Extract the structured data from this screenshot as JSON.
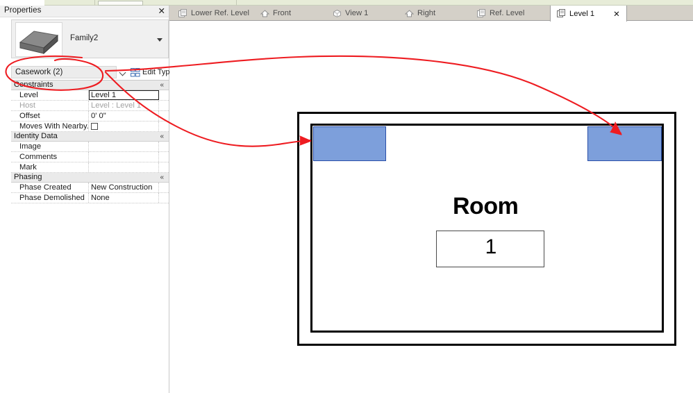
{
  "app": {
    "palette_title": "Properties",
    "close_label": "✕"
  },
  "properties": {
    "type_selector": {
      "family_name": "Family2",
      "thumbnail_icon": "3d-box-thumbnail",
      "dropdown_icon": "caret-down-icon"
    },
    "category_combo": {
      "value": "Casework (2)",
      "caret_icon": "chevron-down-icon"
    },
    "edit_type": {
      "label": "Edit Type",
      "icon": "edit-type-icon"
    },
    "groups": [
      {
        "name": "Constraints",
        "collapse_icon": "«",
        "rows": [
          {
            "name": "Level",
            "value": "Level 1",
            "state": "focused",
            "control": "text"
          },
          {
            "name": "Host",
            "value": "Level : Level 1",
            "state": "disabled",
            "control": "text"
          },
          {
            "name": "Offset",
            "value": "0'  0\"",
            "state": "normal",
            "control": "text"
          },
          {
            "name": "Moves With Nearby...",
            "value": "",
            "state": "normal",
            "control": "checkbox",
            "checked": false
          }
        ]
      },
      {
        "name": "Identity Data",
        "collapse_icon": "«",
        "rows": [
          {
            "name": "Image",
            "value": "",
            "state": "normal",
            "control": "text"
          },
          {
            "name": "Comments",
            "value": "",
            "state": "normal",
            "control": "text"
          },
          {
            "name": "Mark",
            "value": "",
            "state": "normal",
            "control": "text"
          }
        ]
      },
      {
        "name": "Phasing",
        "collapse_icon": "«",
        "rows": [
          {
            "name": "Phase Created",
            "value": "New Construction",
            "state": "normal",
            "control": "text"
          },
          {
            "name": "Phase Demolished",
            "value": "None",
            "state": "normal",
            "control": "text"
          }
        ]
      }
    ]
  },
  "view_tabs": [
    {
      "label": "Lower Ref. Level",
      "icon": "plan-view-icon",
      "active": false
    },
    {
      "label": "Front",
      "icon": "elevation-view-icon",
      "active": false
    },
    {
      "label": "View 1",
      "icon": "3d-view-icon",
      "active": false
    },
    {
      "label": "Right",
      "icon": "elevation-view-icon",
      "active": false
    },
    {
      "label": "Ref. Level",
      "icon": "plan-view-icon",
      "active": false
    },
    {
      "label": "Level 1",
      "icon": "plan-view-icon",
      "active": true,
      "close_label": "✕"
    }
  ],
  "canvas": {
    "room_name": "Room",
    "room_number": "1",
    "casework_count": 2,
    "colors": {
      "casework_fill": "#7d9fdb",
      "casework_stroke": "#2a4fa8",
      "wall_stroke": "#000000",
      "annotation_red": "#ee1c21"
    }
  },
  "annotations": {
    "color": "#ee1c21",
    "shapes": [
      {
        "kind": "ellipse",
        "target": "category-combo-and-constraints-header"
      },
      {
        "kind": "arrow",
        "from": "category-combo-caret",
        "to": "right-casework-element"
      },
      {
        "kind": "arrow",
        "from": "constraints-header",
        "to": "left-casework-element"
      }
    ]
  }
}
